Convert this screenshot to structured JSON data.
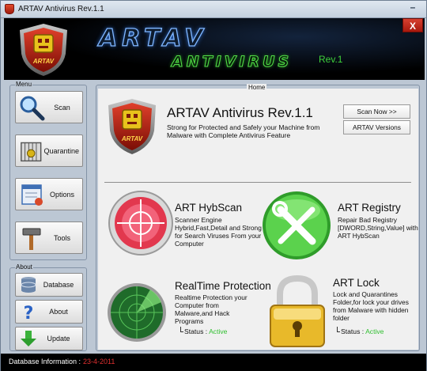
{
  "window": {
    "title": "ARTAV Antivirus Rev.1.1",
    "close_label": "X",
    "minimize_label": "–"
  },
  "banner": {
    "title": "ARTAV",
    "subtitle": "ANTIVIRUS",
    "rev": "Rev.1",
    "logo_text": "ARTAV"
  },
  "menu": {
    "group_title": "Menu",
    "items": [
      {
        "label": "Scan",
        "icon": "magnifier-icon"
      },
      {
        "label": "Quarantine",
        "icon": "quarantine-cage-icon"
      },
      {
        "label": "Options",
        "icon": "options-window-icon"
      },
      {
        "label": "Tools",
        "icon": "hammer-icon"
      }
    ]
  },
  "about": {
    "group_title": "About",
    "items": [
      {
        "label": "Database",
        "icon": "database-icon"
      },
      {
        "label": "About",
        "icon": "question-mark-icon"
      },
      {
        "label": "Update",
        "icon": "download-arrow-icon"
      }
    ]
  },
  "home": {
    "group_title": "Home",
    "heading": "ARTAV Antivirus Rev.1.1",
    "description": "Strong for Protected and Safely your Machine from Malware with Complete Antivirus Feature",
    "logo_text": "ARTAV",
    "buttons": {
      "scan_now": "Scan Now >>",
      "versions": "ARTAV Versions"
    },
    "features": [
      {
        "title": "ART HybScan",
        "description": "Scanner Engine Hybrid,Fast,Detail and Strong for Search Viruses From your Computer",
        "icon": "target-scope-icon"
      },
      {
        "title": "ART Registry",
        "description": "Repair Bad Registry [DWORD,String,Value] with ART HybScan",
        "icon": "wrench-screwdriver-icon"
      },
      {
        "title": "RealTime Protection",
        "description": "Realtime Protection your Computer from Malware,and Hack Programs",
        "icon": "radar-icon",
        "status_label": "Status :",
        "status_value": "Active"
      },
      {
        "title": "ART Lock",
        "description": "Lock and Quarantines Folder,for lock your drives from Malware with hidden folder",
        "icon": "padlock-icon",
        "status_label": "Status :",
        "status_value": "Active"
      }
    ]
  },
  "statusbar": {
    "label": "Database Information :",
    "value": "23-4-2011"
  },
  "colors": {
    "active_status": "#2fbf2f",
    "date": "#e03030",
    "banner_bg": "#000000"
  }
}
